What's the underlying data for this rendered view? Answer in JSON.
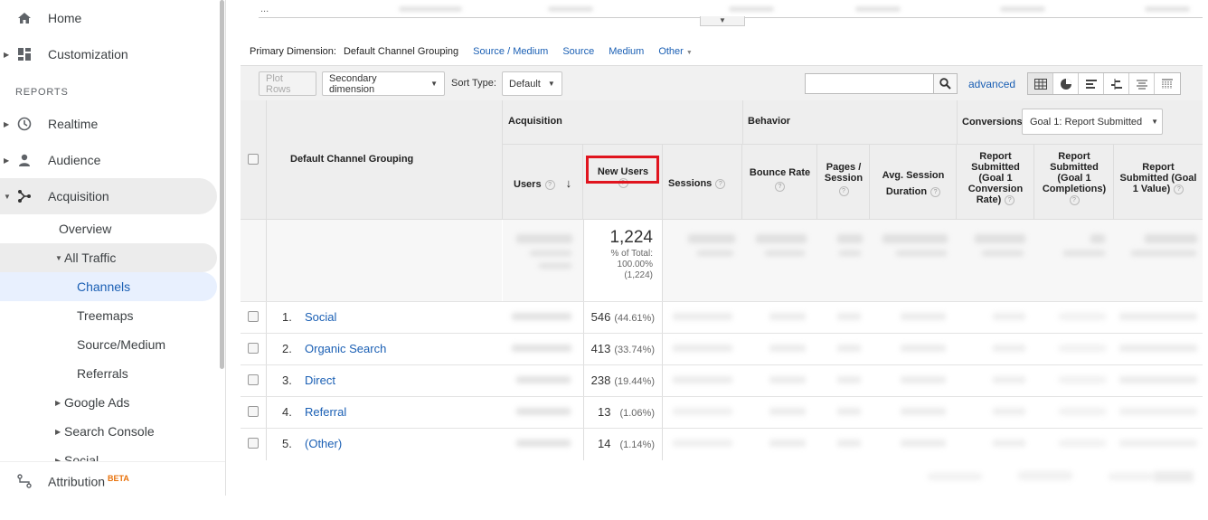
{
  "sidebar": {
    "home": "Home",
    "customization": "Customization",
    "reports_header": "REPORTS",
    "realtime": "Realtime",
    "audience": "Audience",
    "acquisition": "Acquisition",
    "overview": "Overview",
    "all_traffic": "All Traffic",
    "channels": "Channels",
    "treemaps": "Treemaps",
    "source_medium": "Source/Medium",
    "referrals": "Referrals",
    "google_ads": "Google Ads",
    "search_console": "Search Console",
    "social": "Social",
    "attribution": "Attribution",
    "attribution_badge": "BETA"
  },
  "top": {
    "ellipsis": "..."
  },
  "primary_dimension": {
    "label": "Primary Dimension:",
    "active": "Default Channel Grouping",
    "links": [
      "Source / Medium",
      "Source",
      "Medium",
      "Other"
    ]
  },
  "toolbar": {
    "plot_rows": "Plot Rows",
    "secondary_dimension": "Secondary dimension",
    "sort_type_label": "Sort Type:",
    "sort_type_value": "Default",
    "search_value": "",
    "advanced": "advanced"
  },
  "table": {
    "dimension_header": "Default Channel Grouping",
    "groups": {
      "acquisition": "Acquisition",
      "behavior": "Behavior",
      "conversions": "Conversions"
    },
    "goal_select": "Goal 1: Report Submitted",
    "columns": {
      "users": "Users",
      "new_users": "New Users",
      "sessions": "Sessions",
      "bounce_rate": "Bounce Rate",
      "pages_session_1": "Pages /",
      "pages_session_2": "Session",
      "avg_session_1": "Avg. Session",
      "avg_session_2": "Duration",
      "conv_rate_1": "Report",
      "conv_rate_2": "Submitted",
      "conv_rate_3": "(Goal 1",
      "conv_rate_4": "Conversion",
      "conv_rate_5": "Rate)",
      "completions_1": "Report",
      "completions_2": "Submitted",
      "completions_3": "(Goal 1",
      "completions_4": "Completions)",
      "value_1": "Report",
      "value_2": "Submitted (Goal",
      "value_3": "1 Value)"
    },
    "totals": {
      "new_users": "1,224",
      "pct_label": "% of Total:",
      "pct_value": "100.00%",
      "pct_abs": "(1,224)"
    },
    "rows": [
      {
        "num": "1.",
        "channel": "Social",
        "new_users": "546",
        "pct": "(44.61%)"
      },
      {
        "num": "2.",
        "channel": "Organic Search",
        "new_users": "413",
        "pct": "(33.74%)"
      },
      {
        "num": "3.",
        "channel": "Direct",
        "new_users": "238",
        "pct": "(19.44%)"
      },
      {
        "num": "4.",
        "channel": "Referral",
        "new_users": "13",
        "pct": "(1.06%)"
      },
      {
        "num": "5.",
        "channel": "(Other)",
        "new_users": "14",
        "pct": "(1.14%)"
      }
    ]
  },
  "colors": {
    "link": "#1a5fb4",
    "highlight": "#e0141e",
    "beta": "#e8710a",
    "active_nav": "#e8f0fe"
  }
}
